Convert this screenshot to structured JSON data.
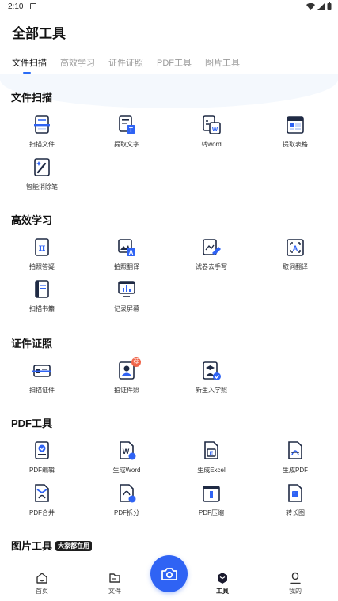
{
  "status_bar": {
    "time": "2:10"
  },
  "page": {
    "title": "全部工具"
  },
  "tabs": [
    "文件扫描",
    "高效学习",
    "证件证照",
    "PDF工具",
    "图片工具"
  ],
  "sections": {
    "scan": {
      "title": "文件扫描",
      "items": [
        "扫描文件",
        "提取文字",
        "转word",
        "提取表格",
        "智能消除笔"
      ]
    },
    "study": {
      "title": "高效学习",
      "items": [
        "拍照答疑",
        "拍照翻译",
        "试卷去手写",
        "取词翻译",
        "扫描书籍",
        "记录屏幕"
      ]
    },
    "id": {
      "title": "证件证照",
      "items": [
        "扫描证件",
        "拍证件照",
        "新生入学照"
      ],
      "hot_badge": "荐"
    },
    "pdf": {
      "title": "PDF工具",
      "items": [
        "PDF编辑",
        "生成Word",
        "生成Excel",
        "生成PDF",
        "PDF合并",
        "PDF拆分",
        "PDF压缩",
        "转长图"
      ]
    },
    "image": {
      "title": "图片工具",
      "badge": "大家都在用"
    }
  },
  "bottom_nav": {
    "home": "首页",
    "files": "文件",
    "tools": "工具",
    "mine": "我的"
  },
  "colors": {
    "accent": "#2f63f4",
    "badge_red": "#f0654a"
  }
}
